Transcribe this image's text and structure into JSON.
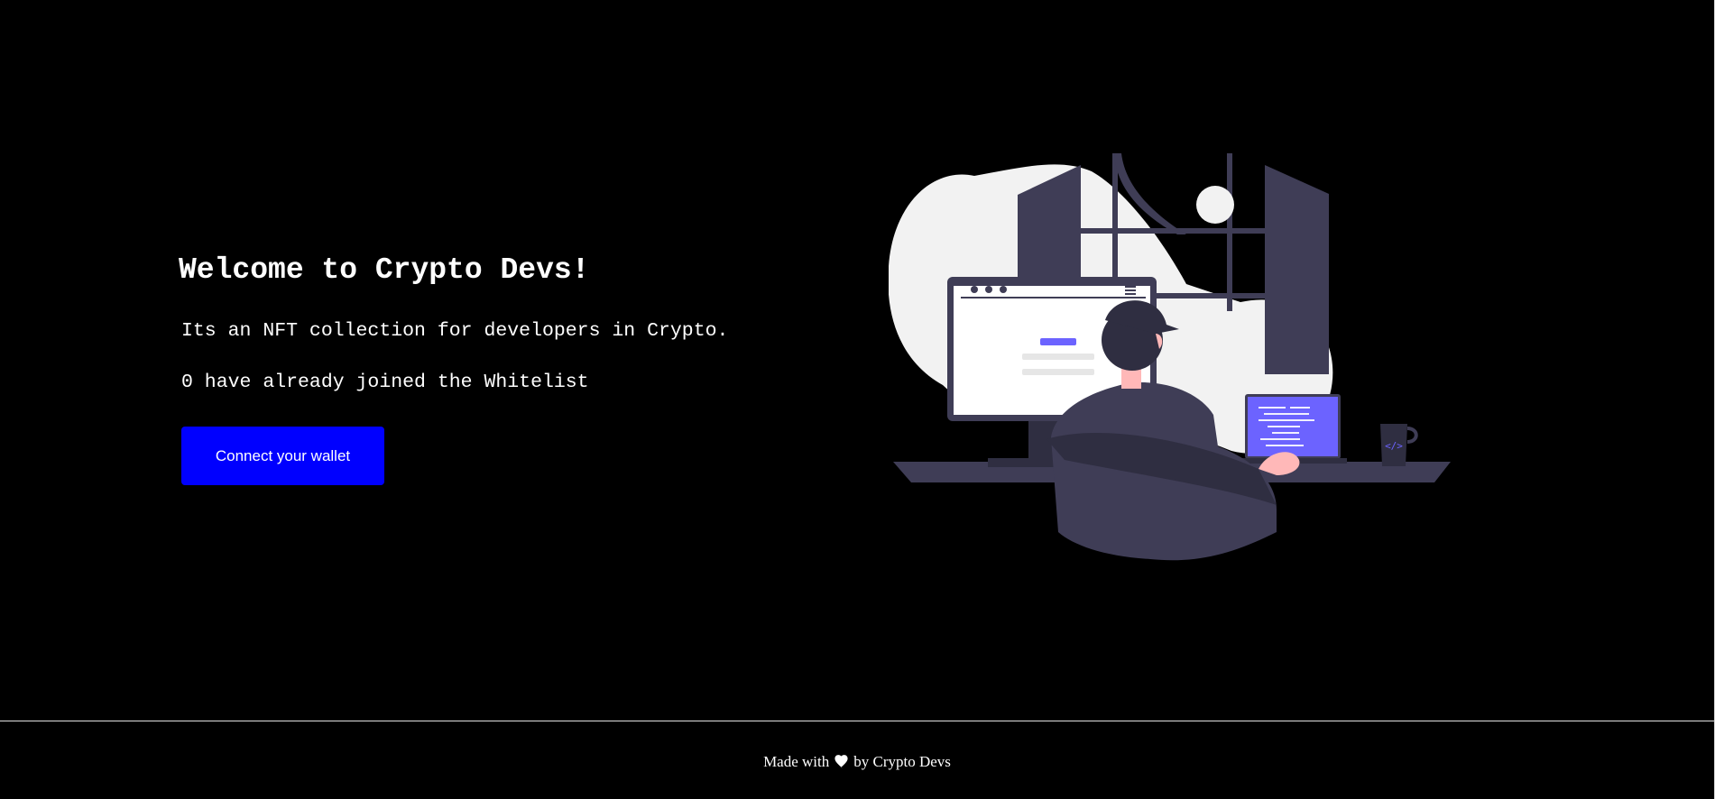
{
  "main": {
    "title": "Welcome to Crypto Devs!",
    "description": "Its an NFT collection for developers in Crypto.",
    "whitelist_status": "0 have already joined the Whitelist",
    "connect_button_label": "Connect your wallet"
  },
  "illustration": {
    "icon": "developer-at-desk-illustration",
    "accent_color": "#6c63ff",
    "dark_color": "#3f3d56",
    "light_color": "#f2f2f2",
    "skin_color": "#ffb8b8"
  },
  "footer": {
    "prefix": "Made with",
    "heart_icon": "heart-icon",
    "suffix": "by Crypto Devs"
  },
  "colors": {
    "background": "#000000",
    "text": "#ffffff",
    "button": "#0000ff"
  }
}
